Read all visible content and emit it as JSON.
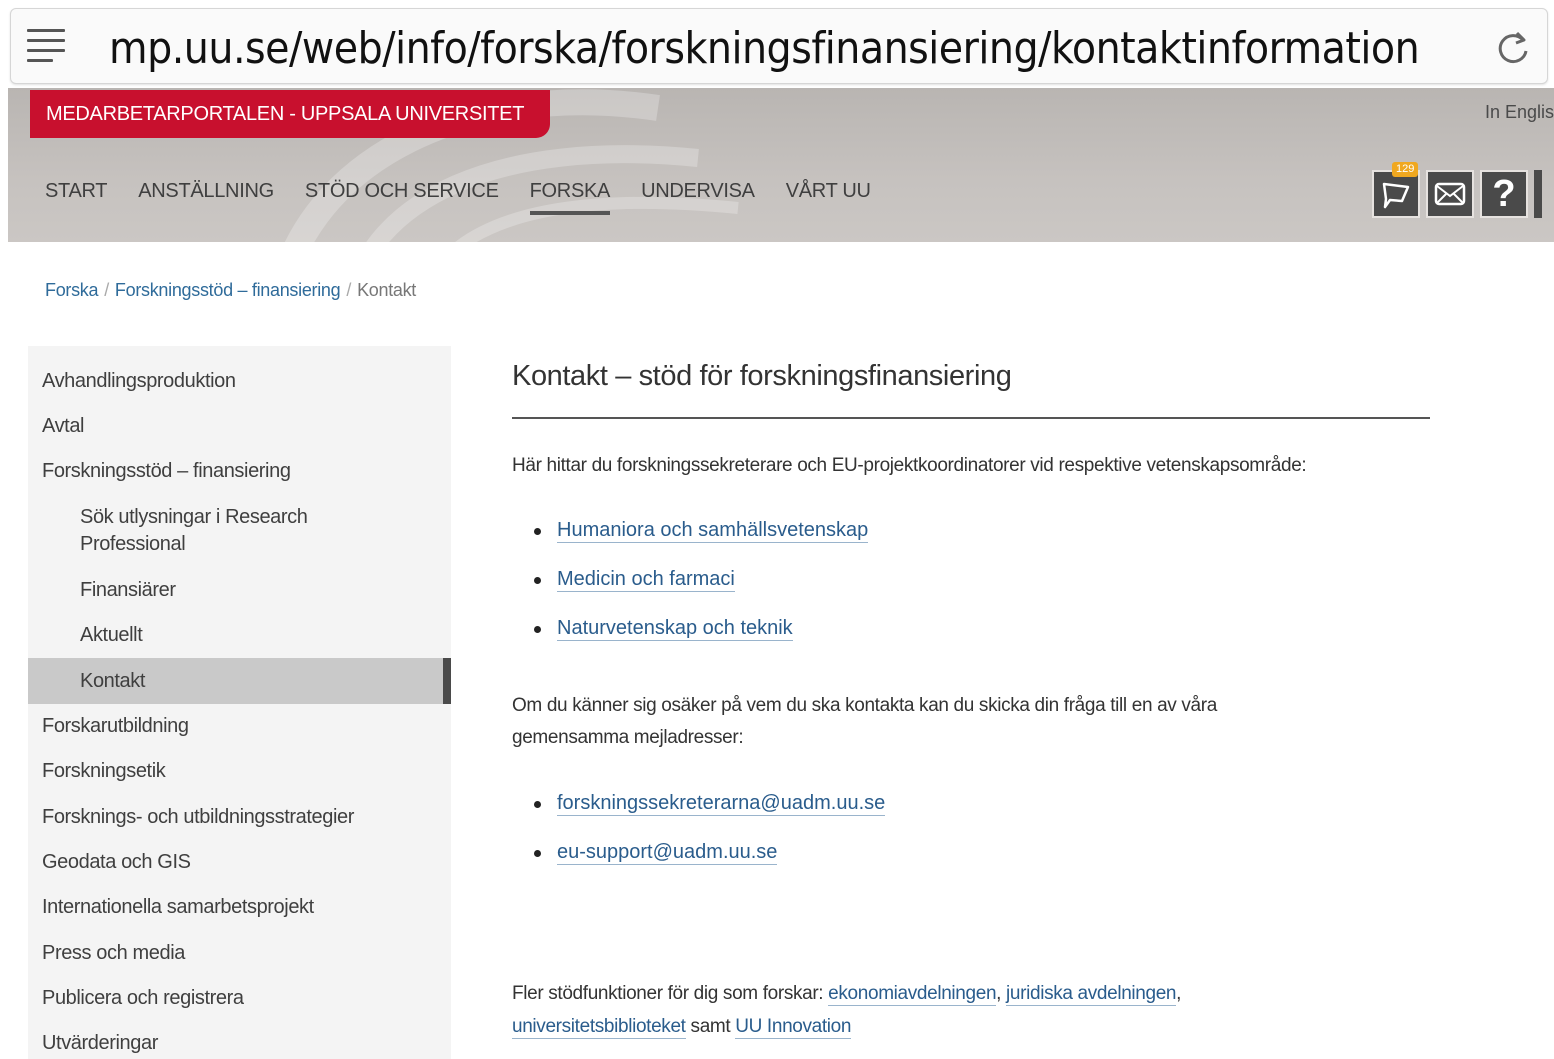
{
  "browser": {
    "url": "mp.uu.se/web/info/forska/forskningsfinansiering/kontaktinformation"
  },
  "header": {
    "brand": "MEDARBETARPORTALEN - UPPSALA UNIVERSITET",
    "language_link": "In Englis",
    "nav": [
      "START",
      "ANSTÄLLNING",
      "STÖD OCH SERVICE",
      "FORSKA",
      "UNDERVISA",
      "VÅRT UU"
    ],
    "active_nav": "FORSKA",
    "notification_count": "129"
  },
  "breadcrumb": {
    "items": [
      "Forska",
      "Forskningsstöd – finansiering"
    ],
    "separator": "/",
    "current": "Kontakt"
  },
  "sidebar": {
    "items": [
      {
        "label": "Avhandlingsproduktion"
      },
      {
        "label": "Avtal"
      },
      {
        "label": "Forskningsstöd – finansiering"
      },
      {
        "label": "Sök utlysningar i Research Professional"
      },
      {
        "label": "Finansiärer"
      },
      {
        "label": "Aktuellt"
      },
      {
        "label": "Kontakt"
      },
      {
        "label": "Forskarutbildning"
      },
      {
        "label": "Forskningsetik"
      },
      {
        "label": "Forsknings- och utbildningsstrategier"
      },
      {
        "label": "Geodata och GIS"
      },
      {
        "label": "Internationella samarbetsprojekt"
      },
      {
        "label": "Press och media"
      },
      {
        "label": "Publicera och registrera"
      },
      {
        "label": "Utvärderingar"
      }
    ]
  },
  "main": {
    "title": "Kontakt – stöd för forskningsfinansiering",
    "intro": "Här hittar du forskningssekreterare och EU-projektkoordinatorer vid respektive vetenskapsområde:",
    "areas": [
      "Humaniora och samhällsvetenskap",
      "Medicin och farmaci",
      "Naturvetenskap och teknik"
    ],
    "unsure_line1": "Om du känner sig osäker på vem du ska kontakta kan du skicka din fråga till en av våra",
    "unsure_line2": "gemensamma mejladresser:",
    "emails": [
      "forskningssekreterarna@uadm.uu.se",
      "eu-support@uadm.uu.se"
    ],
    "more_prefix": "Fler stödfunktioner för dig som forskar: ",
    "more_links": [
      "ekonomiavdelningen",
      "juridiska avdelningen",
      "universitetsbiblioteket",
      "UU Innovation"
    ],
    "more_comma": ",",
    "more_and": " samt "
  }
}
